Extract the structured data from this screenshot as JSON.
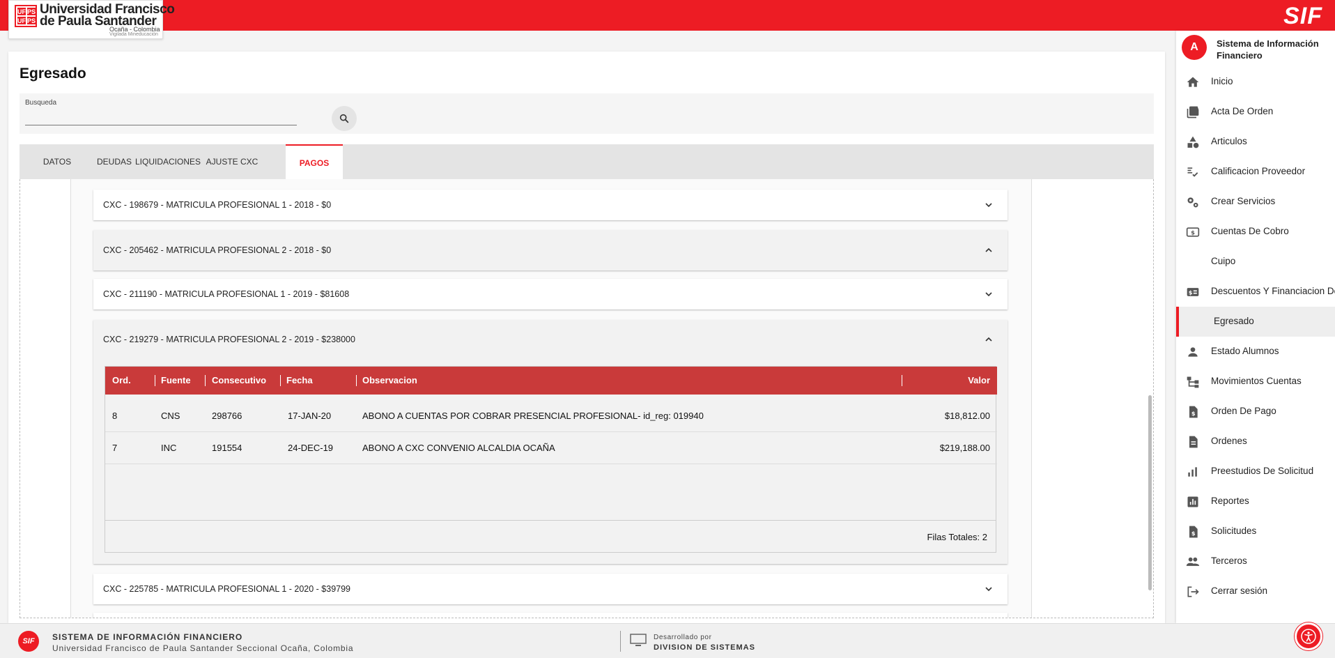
{
  "header": {
    "logo_line1": "Universidad Francisco",
    "logo_line2": "de Paula Santander",
    "logo_line3": "Ocaña - Colombia",
    "logo_line4": "Vigilada Mineducación",
    "logo_mark": [
      "UF",
      "PS",
      "UF",
      "PS"
    ],
    "brand": "SIF",
    "accent_color": "#ed1c24"
  },
  "page": {
    "title": "Egresado",
    "search_label": "Busqueda",
    "search_value": "",
    "search_icon": "search-icon"
  },
  "tabs": [
    {
      "label": "DATOS",
      "active": false
    },
    {
      "label": "DEUDAS",
      "active": false
    },
    {
      "label": "LIQUIDACIONES",
      "active": false
    },
    {
      "label": "AJUSTE CXC",
      "active": false
    },
    {
      "label": "PAGOS",
      "active": true
    }
  ],
  "panels": [
    {
      "title": "CXC - 198679 - MATRICULA PROFESIONAL 1 - 2018 - $0",
      "expanded": false
    },
    {
      "title": "CXC - 205462 - MATRICULA PROFESIONAL 2 - 2018 - $0",
      "expanded": true
    },
    {
      "title": "CXC - 211190 - MATRICULA PROFESIONAL 1 - 2019 - $81608",
      "expanded": false
    },
    {
      "title": "CXC - 219279 - MATRICULA PROFESIONAL 2 - 2019 - $238000",
      "expanded": true
    },
    {
      "title": "CXC - 225785 - MATRICULA PROFESIONAL 1 - 2020 - $39799",
      "expanded": false
    }
  ],
  "payments_table": {
    "columns": [
      "Ord.",
      "Fuente",
      "Consecutivo",
      "Fecha",
      "Observacion",
      "Valor"
    ],
    "rows": [
      {
        "ord": "8",
        "fuente": "CNS",
        "consecutivo": "298766",
        "fecha": "17-JAN-20",
        "observacion": "ABONO A CUENTAS POR COBRAR PRESENCIAL PROFESIONAL- id_reg: 019940",
        "valor": "$18,812.00"
      },
      {
        "ord": "7",
        "fuente": "INC",
        "consecutivo": "191554",
        "fecha": "24-DEC-19",
        "observacion": "ABONO A CXC CONVENIO ALCALDIA OCAÑA",
        "valor": "$219,188.00"
      }
    ],
    "footer": "Filas Totales: 2",
    "header_color": "#c93a3a"
  },
  "sidebar": {
    "avatar": "A",
    "app_name": "Sistema de Información Financiero",
    "items": [
      {
        "label": "Inicio",
        "icon": "home-icon"
      },
      {
        "label": "Acta De Orden",
        "icon": "documents-icon"
      },
      {
        "label": "Articulos",
        "icon": "shapes-icon"
      },
      {
        "label": "Calificacion Proveedor",
        "icon": "rating-icon"
      },
      {
        "label": "Crear Servicios",
        "icon": "gears-icon"
      },
      {
        "label": "Cuentas De Cobro",
        "icon": "money-icon"
      },
      {
        "label": "Cuipo",
        "icon": ""
      },
      {
        "label": "Descuentos Y Financiacion De",
        "icon": "discount-icon"
      },
      {
        "label": "Egresado",
        "icon": "",
        "active": true
      },
      {
        "label": "Estado Alumnos",
        "icon": "person-icon"
      },
      {
        "label": "Movimientos Cuentas",
        "icon": "tree-icon"
      },
      {
        "label": "Orden De Pago",
        "icon": "dollar-file-icon"
      },
      {
        "label": "Ordenes",
        "icon": "file-icon"
      },
      {
        "label": "Preestudios De Solicitud",
        "icon": "chart-icon"
      },
      {
        "label": "Reportes",
        "icon": "report-icon"
      },
      {
        "label": "Solicitudes",
        "icon": "dollar-file-icon"
      },
      {
        "label": "Terceros",
        "icon": "people-icon"
      },
      {
        "label": "Cerrar sesión",
        "icon": "logout-icon"
      }
    ]
  },
  "footer": {
    "logo": "SIF",
    "title": "SISTEMA DE INFORMACIÓN FINANCIERO",
    "subtitle": "Universidad Francisco de Paula Santander Seccional Ocaña, Colombia",
    "dev_label": "Desarrollado por",
    "dev_name": "DIVISION DE SISTEMAS"
  }
}
